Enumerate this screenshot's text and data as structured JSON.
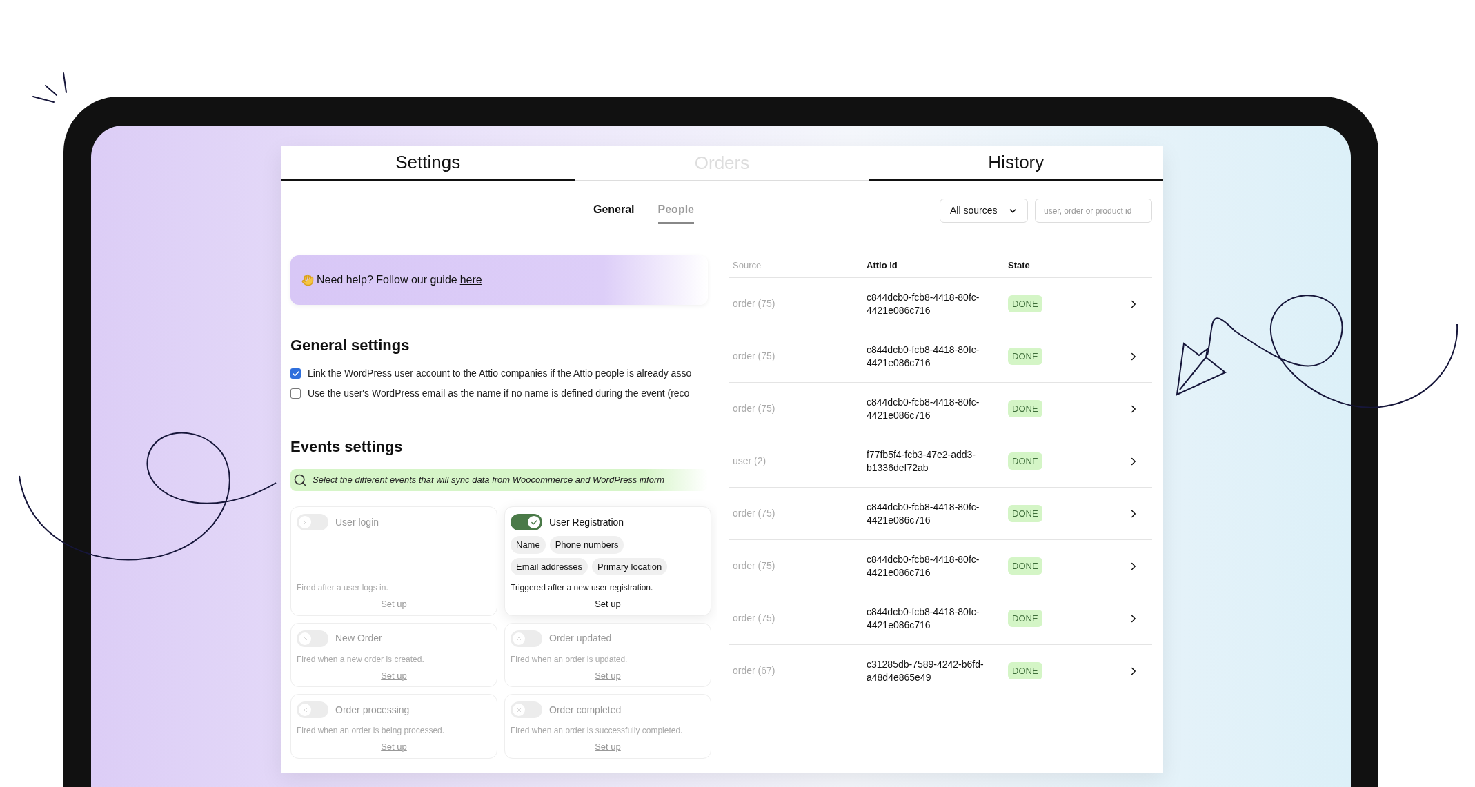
{
  "tabs": [
    {
      "label": "Settings",
      "selected": true
    },
    {
      "label": "Orders",
      "selected": false
    },
    {
      "label": "History",
      "selected": true
    }
  ],
  "settings": {
    "subtabs": [
      {
        "label": "General",
        "selected": false
      },
      {
        "label": "People",
        "selected": true
      }
    ],
    "help": {
      "text": "Need help? Follow our guide",
      "link": "here"
    },
    "general": {
      "title": "General settings",
      "options": [
        {
          "label": "Link the WordPress user account to the Attio companies if the Attio people is already asso",
          "checked": true
        },
        {
          "label": "Use the user's WordPress email as the name if no name is defined during the event (reco",
          "checked": false
        }
      ]
    },
    "events": {
      "title": "Events settings",
      "hint": "Select the different events that will sync data from Woocommerce and WordPress inform",
      "cards": [
        {
          "name": "User login",
          "on": false,
          "description": "Fired after a user logs in.",
          "action": "Set up"
        },
        {
          "name": "User Registration",
          "on": true,
          "tags": [
            "Name",
            "Phone numbers",
            "Email addresses",
            "Primary location"
          ],
          "description": "Triggered after a new user registration.",
          "action": "Set up"
        },
        {
          "name": "New Order",
          "on": false,
          "description": "Fired when a new order is created.",
          "action": "Set up"
        },
        {
          "name": "Order updated",
          "on": false,
          "description": "Fired when an order is updated.",
          "action": "Set up"
        },
        {
          "name": "Order processing",
          "on": false,
          "description": "Fired when an order is being processed.",
          "action": "Set up"
        },
        {
          "name": "Order completed",
          "on": false,
          "description": "Fired when an order is successfully completed.",
          "action": "Set up"
        }
      ]
    }
  },
  "history": {
    "source_filter": "All sources",
    "search": {
      "placeholder": "user, order or product id"
    },
    "columns": [
      "Source",
      "Attio id",
      "State"
    ],
    "rows": [
      {
        "source": "order (75)",
        "attio_id": "c844dcb0-fcb8-4418-80fc-4421e086c716",
        "state": "DONE"
      },
      {
        "source": "order (75)",
        "attio_id": "c844dcb0-fcb8-4418-80fc-4421e086c716",
        "state": "DONE"
      },
      {
        "source": "order (75)",
        "attio_id": "c844dcb0-fcb8-4418-80fc-4421e086c716",
        "state": "DONE"
      },
      {
        "source": "user (2)",
        "attio_id": "f77fb5f4-fcb3-47e2-add3-b1336def72ab",
        "state": "DONE"
      },
      {
        "source": "order (75)",
        "attio_id": "c844dcb0-fcb8-4418-80fc-4421e086c716",
        "state": "DONE"
      },
      {
        "source": "order (75)",
        "attio_id": "c844dcb0-fcb8-4418-80fc-4421e086c716",
        "state": "DONE"
      },
      {
        "source": "order (75)",
        "attio_id": "c844dcb0-fcb8-4418-80fc-4421e086c716",
        "state": "DONE"
      },
      {
        "source": "order (67)",
        "attio_id": "c31285db-7589-4242-b6fd-a48d4e865e49",
        "state": "DONE"
      }
    ]
  }
}
